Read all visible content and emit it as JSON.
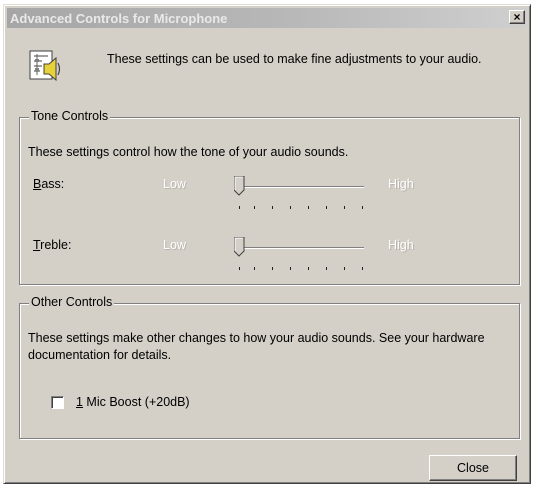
{
  "window": {
    "title": "Advanced Controls for Microphone",
    "close_glyph": "×"
  },
  "header": {
    "icon": "speaker-settings-icon",
    "text": "These settings can be used to make fine adjustments to your audio."
  },
  "tone": {
    "title": "Tone Controls",
    "description": "These settings control how the tone of your audio sounds.",
    "bass": {
      "mnemonic": "B",
      "label_rest": "ass:",
      "min_label": "Low",
      "max_label": "High",
      "level": 0
    },
    "treble": {
      "mnemonic": "T",
      "label_rest": "reble:",
      "min_label": "Low",
      "max_label": "High",
      "level": 0
    }
  },
  "other": {
    "title": "Other Controls",
    "description": "These settings make other changes to how your audio sounds.  See your hardware documentation for details.",
    "mic_boost": {
      "mnemonic": "1",
      "label_rest": " Mic Boost (+20dB)",
      "checked": false
    }
  },
  "buttons": {
    "close": "Close"
  }
}
